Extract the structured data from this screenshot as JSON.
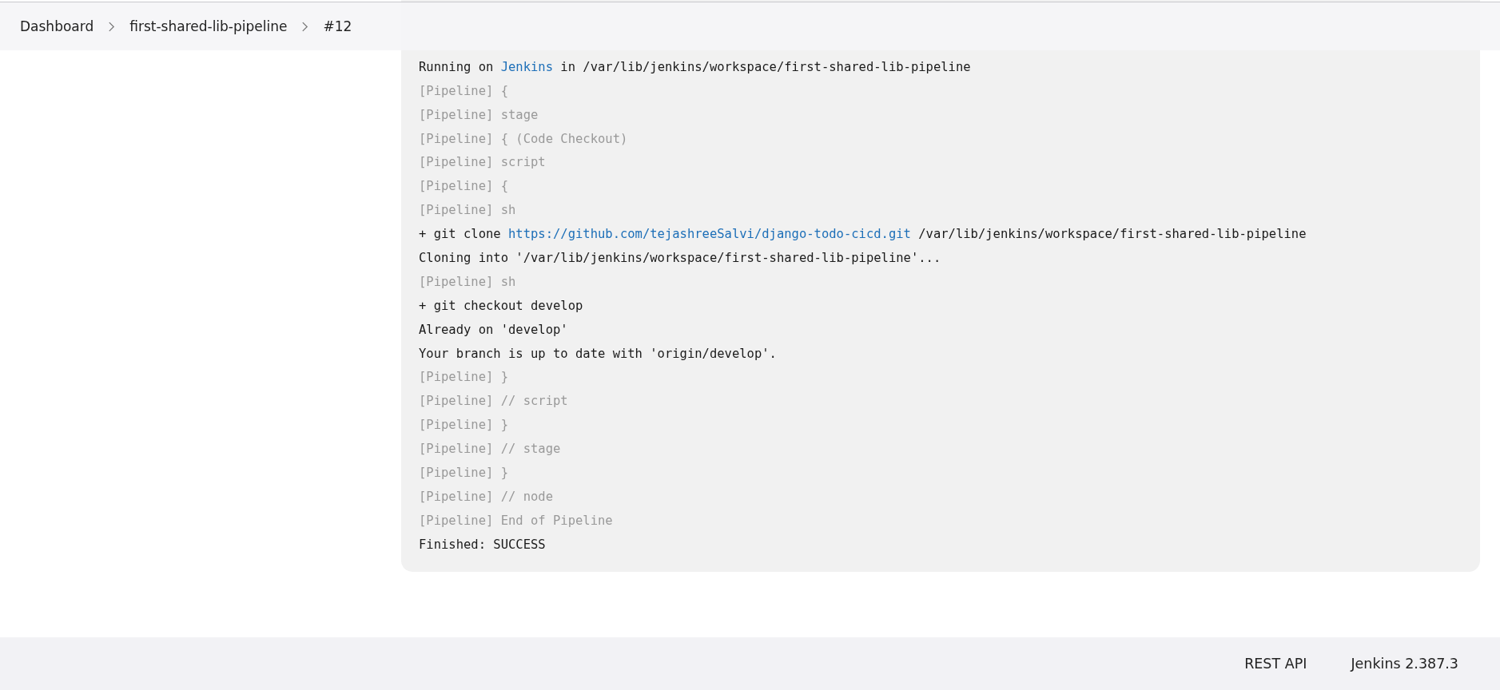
{
  "breadcrumbs": [
    {
      "label": "Dashboard"
    },
    {
      "label": "first-shared-lib-pipeline"
    },
    {
      "label": "#12"
    }
  ],
  "console": [
    {
      "kind": "output",
      "parts": [
        {
          "text": "Running on "
        },
        {
          "text": "Jenkins",
          "kind": "link"
        },
        {
          "text": " in /var/lib/jenkins/workspace/first-shared-lib-pipeline"
        }
      ]
    },
    {
      "kind": "pipeline",
      "parts": [
        {
          "text": "[Pipeline] {"
        }
      ]
    },
    {
      "kind": "pipeline",
      "parts": [
        {
          "text": "[Pipeline] stage"
        }
      ]
    },
    {
      "kind": "pipeline",
      "parts": [
        {
          "text": "[Pipeline] { (Code Checkout)"
        }
      ]
    },
    {
      "kind": "pipeline",
      "parts": [
        {
          "text": "[Pipeline] script"
        }
      ]
    },
    {
      "kind": "pipeline",
      "parts": [
        {
          "text": "[Pipeline] {"
        }
      ]
    },
    {
      "kind": "pipeline",
      "parts": [
        {
          "text": "[Pipeline] sh"
        }
      ]
    },
    {
      "kind": "output",
      "parts": [
        {
          "text": "+ git clone "
        },
        {
          "text": "https://github.com/tejashreeSalvi/django-todo-cicd.git",
          "kind": "link"
        },
        {
          "text": " /var/lib/jenkins/workspace/first-shared-lib-pipeline"
        }
      ]
    },
    {
      "kind": "output",
      "parts": [
        {
          "text": "Cloning into '/var/lib/jenkins/workspace/first-shared-lib-pipeline'..."
        }
      ]
    },
    {
      "kind": "pipeline",
      "parts": [
        {
          "text": "[Pipeline] sh"
        }
      ]
    },
    {
      "kind": "output",
      "parts": [
        {
          "text": "+ git checkout develop"
        }
      ]
    },
    {
      "kind": "output",
      "parts": [
        {
          "text": "Already on 'develop'"
        }
      ]
    },
    {
      "kind": "output",
      "parts": [
        {
          "text": "Your branch is up to date with 'origin/develop'."
        }
      ]
    },
    {
      "kind": "pipeline",
      "parts": [
        {
          "text": "[Pipeline] }"
        }
      ]
    },
    {
      "kind": "pipeline",
      "parts": [
        {
          "text": "[Pipeline] // script"
        }
      ]
    },
    {
      "kind": "pipeline",
      "parts": [
        {
          "text": "[Pipeline] }"
        }
      ]
    },
    {
      "kind": "pipeline",
      "parts": [
        {
          "text": "[Pipeline] // stage"
        }
      ]
    },
    {
      "kind": "pipeline",
      "parts": [
        {
          "text": "[Pipeline] }"
        }
      ]
    },
    {
      "kind": "pipeline",
      "parts": [
        {
          "text": "[Pipeline] // node"
        }
      ]
    },
    {
      "kind": "pipeline",
      "parts": [
        {
          "text": "[Pipeline] End of Pipeline"
        }
      ]
    },
    {
      "kind": "output",
      "parts": [
        {
          "text": "Finished: SUCCESS"
        }
      ]
    }
  ],
  "footer": {
    "links": [
      "REST API",
      "Jenkins 2.387.3"
    ]
  }
}
